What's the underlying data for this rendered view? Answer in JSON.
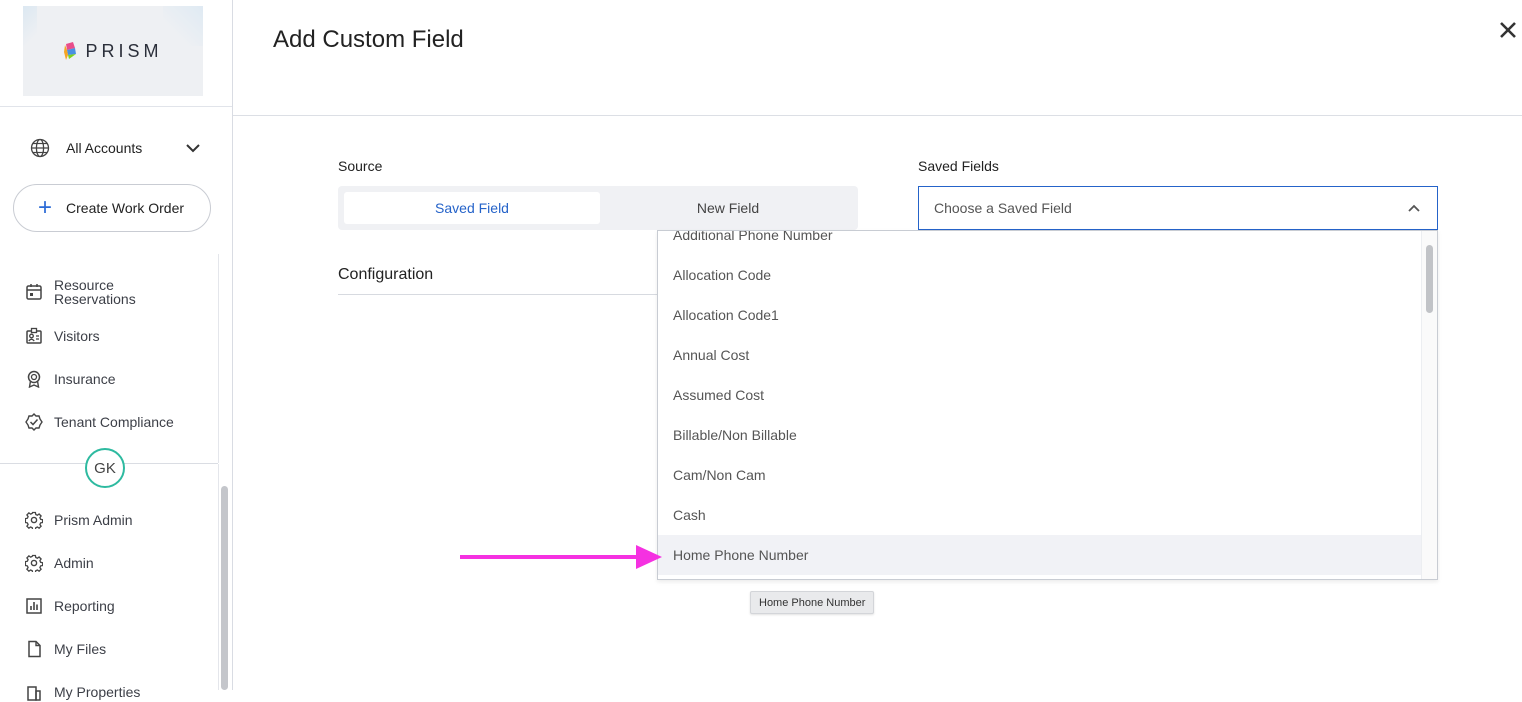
{
  "app": {
    "logo_text": "PRISM"
  },
  "sidebar": {
    "account_selector": {
      "label": "All Accounts"
    },
    "create_button": {
      "label": "Create Work Order"
    },
    "nav_items": [
      {
        "label_line1": "Resource",
        "label_line2": "Reservations",
        "icon": "calendar-icon"
      },
      {
        "label": "Visitors",
        "icon": "visitor-badge-icon"
      },
      {
        "label": "Insurance",
        "icon": "insurance-ribbon-icon"
      },
      {
        "label": "Tenant Compliance",
        "icon": "compliance-check-icon"
      }
    ],
    "user_avatar": {
      "initials": "GK"
    },
    "lower_nav_items": [
      {
        "label": "Prism Admin",
        "icon": "gear-icon"
      },
      {
        "label": "Admin",
        "icon": "gear-icon"
      },
      {
        "label": "Reporting",
        "icon": "bar-chart-icon"
      },
      {
        "label": "My Files",
        "icon": "file-icon"
      },
      {
        "label": "My Properties",
        "icon": "building-icon"
      }
    ]
  },
  "modal": {
    "title": "Add Custom Field",
    "close_icon": "close-icon",
    "source": {
      "label": "Source",
      "options": [
        "Saved Field",
        "New Field"
      ],
      "selected": "Saved Field"
    },
    "configuration": {
      "label": "Configuration"
    },
    "saved_fields": {
      "label": "Saved Fields",
      "placeholder": "Choose a Saved Field",
      "options": [
        "Additional Phone Number",
        "Allocation Code",
        "Allocation Code1",
        "Annual Cost",
        "Assumed Cost",
        "Billable/Non Billable",
        "Cam/Non Cam",
        "Cash",
        "Home Phone Number"
      ],
      "hovered": "Home Phone Number"
    },
    "tooltip": "Home Phone Number"
  },
  "colors": {
    "accent": "#2563c9",
    "avatar_ring": "#2ebaa0",
    "annotation_arrow": "#f531e1"
  }
}
